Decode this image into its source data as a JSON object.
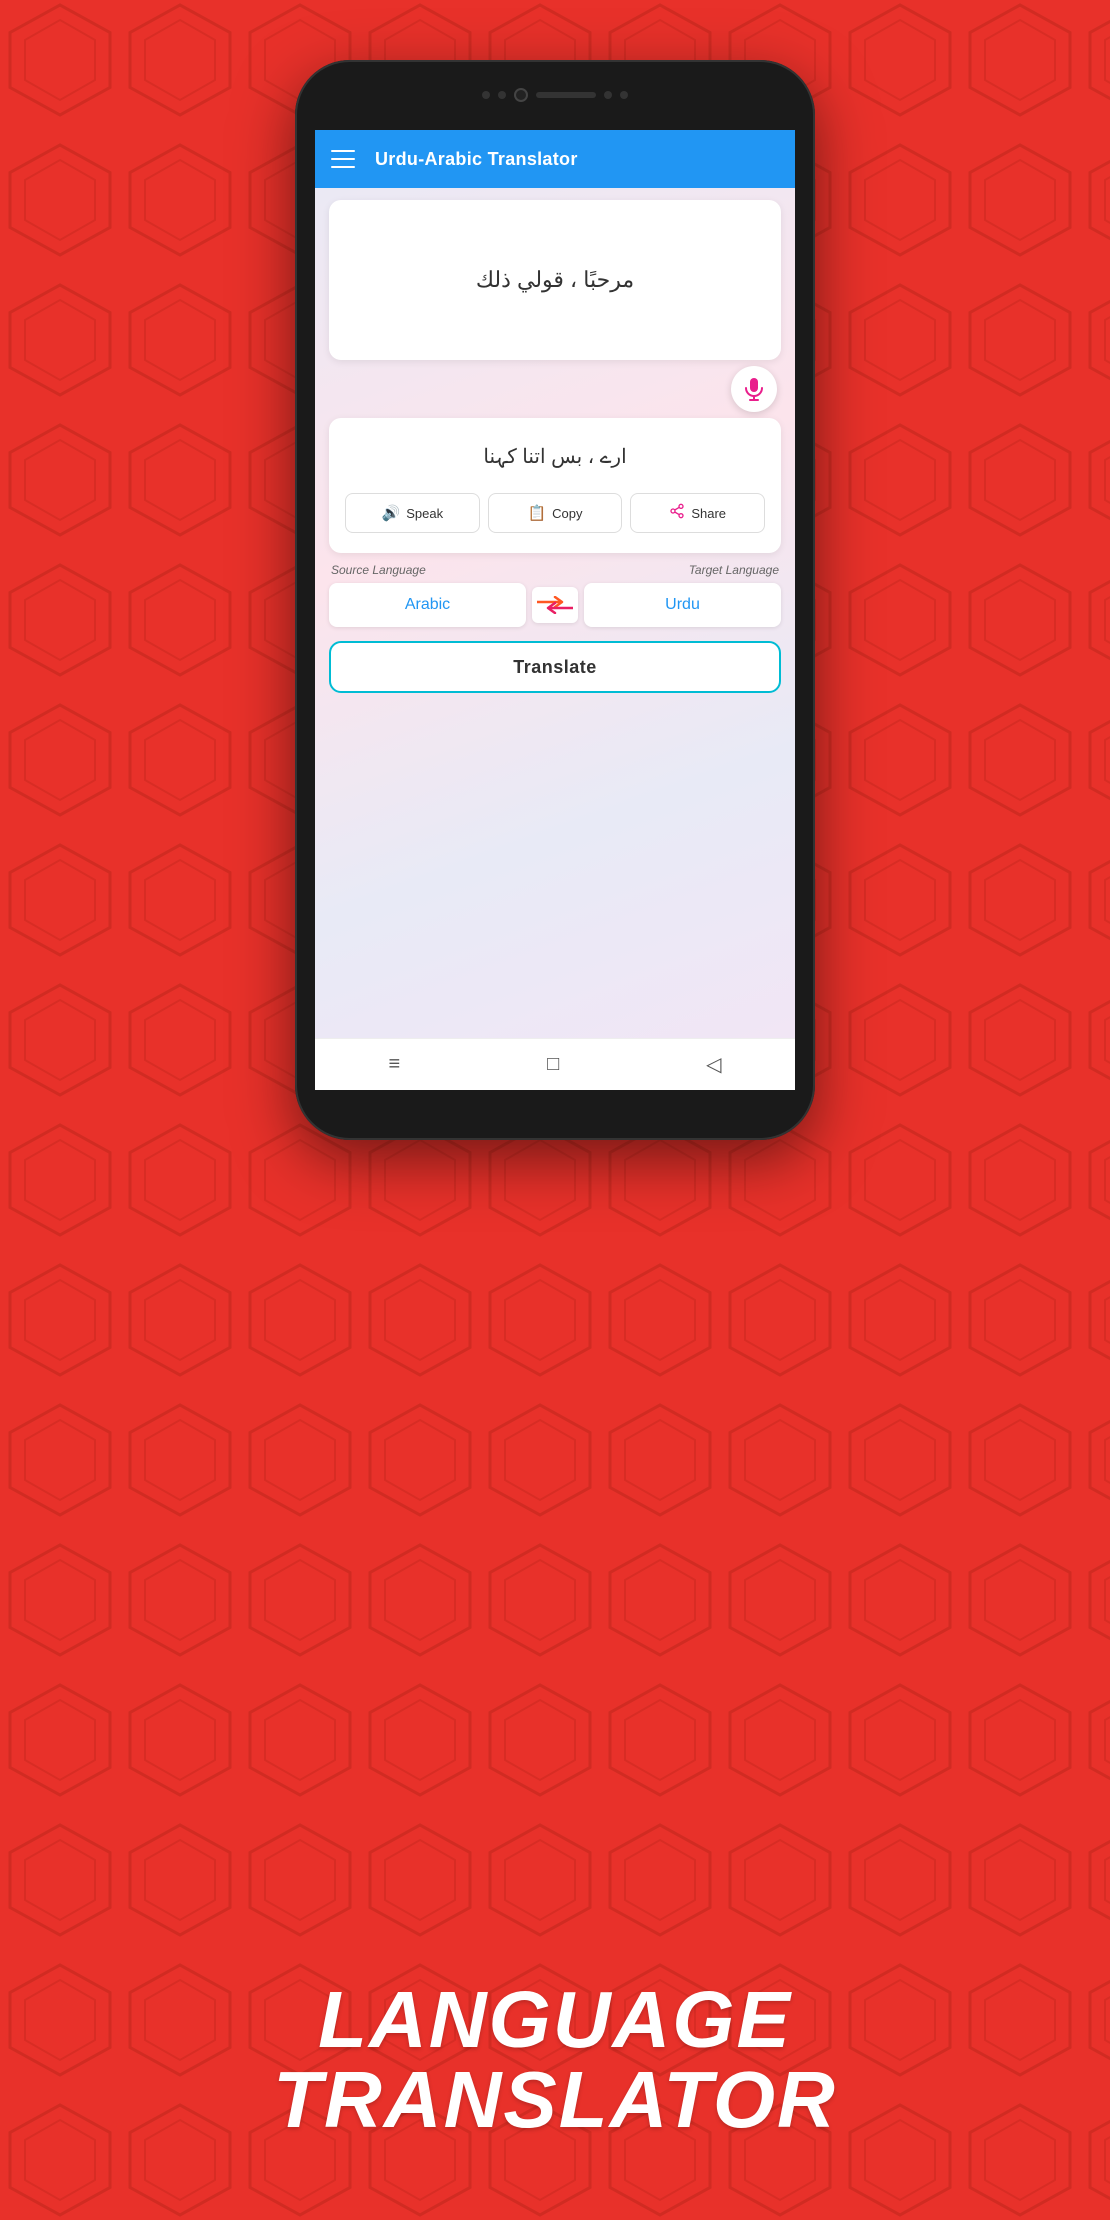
{
  "app": {
    "title": "Urdu-Arabic Translator",
    "background_color": "#e8312a"
  },
  "header": {
    "menu_icon": "≡",
    "title": "Urdu-Arabic Translator"
  },
  "translation_input": {
    "arabic_text": "مرحبًا ، قولي ذلك"
  },
  "translation_output": {
    "urdu_text": "ارے ، بس اتنا کہنا"
  },
  "action_buttons": {
    "speak_label": "Speak",
    "copy_label": "Copy",
    "share_label": "Share"
  },
  "language_section": {
    "source_label": "Source Language",
    "target_label": "Target Language",
    "source_lang": "Arabic",
    "target_lang": "Urdu"
  },
  "translate_button": {
    "label": "Translate"
  },
  "bottom_nav": {
    "menu_icon": "≡",
    "home_icon": "□",
    "back_icon": "◁"
  },
  "bottom_title": {
    "line1": "LANGUAGE",
    "line2": "TRANSLATOR"
  }
}
